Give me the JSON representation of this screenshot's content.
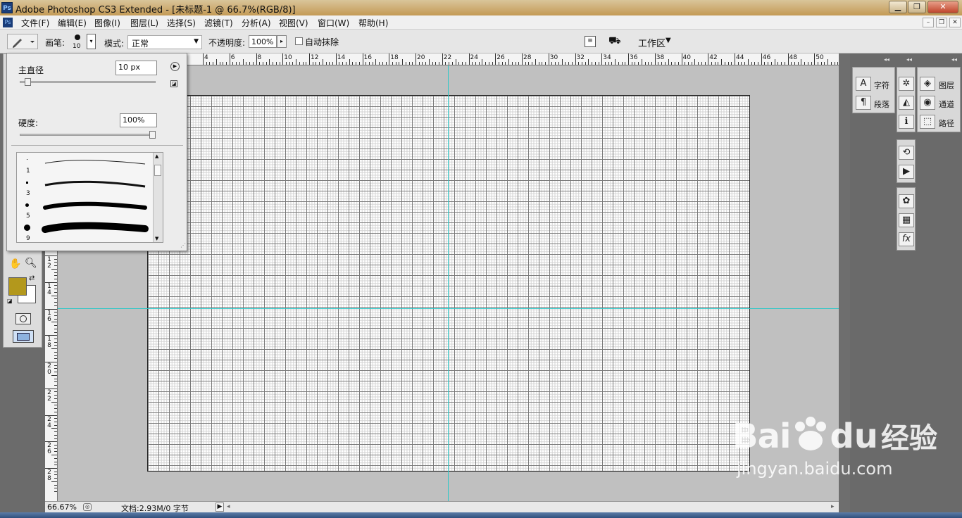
{
  "window": {
    "app_icon": "Ps",
    "title": "Adobe Photoshop CS3 Extended - [未标题-1 @ 66.7%(RGB/8)]",
    "controls": [
      "▁",
      "❐",
      "✕"
    ]
  },
  "menubar": {
    "items": [
      "文件(F)",
      "编辑(E)",
      "图像(I)",
      "图层(L)",
      "选择(S)",
      "滤镜(T)",
      "分析(A)",
      "视图(V)",
      "窗口(W)",
      "帮助(H)"
    ],
    "doc_controls": [
      "–",
      "❐",
      "✕"
    ]
  },
  "options": {
    "brush_label": "画笔:",
    "brush_size": "10",
    "mode_label": "模式:",
    "mode_value": "正常",
    "opacity_label": "不透明度:",
    "opacity_value": "100%",
    "auto_erase_label": "自动抹除",
    "workspace_label": "工作区"
  },
  "brush_popup": {
    "diameter_label": "主直径",
    "diameter_value": "10 px",
    "hardness_label": "硬度:",
    "hardness_value": "100%",
    "diameter_fraction": 0.04,
    "hardness_fraction": 1.0,
    "presets": [
      "1",
      "3",
      "5",
      "9"
    ]
  },
  "rulers": {
    "top_ticks": [
      "4",
      "6",
      "8",
      "10",
      "12",
      "14",
      "16",
      "18",
      "20",
      "22",
      "24",
      "26",
      "28",
      "30",
      "32",
      "34",
      "36",
      "38",
      "40",
      "42",
      "44",
      "46",
      "48",
      "50"
    ],
    "left_ticks": [
      "12",
      "14",
      "16",
      "18",
      "20",
      "22",
      "24",
      "26",
      "28"
    ]
  },
  "status": {
    "zoom": "66.67%",
    "doc_info": "文档:2.93M/0 字节"
  },
  "panels": {
    "group1": [
      "字符",
      "段落"
    ],
    "group3": [
      "图层",
      "通道",
      "路径"
    ]
  },
  "colors": {
    "foreground": "#b3981c",
    "background": "#ffffff",
    "guide": "#2ec7c7"
  },
  "watermark": {
    "brand": "Bai",
    "brand2": "du",
    "cn": "经验",
    "url": "jingyan.baidu.com"
  }
}
